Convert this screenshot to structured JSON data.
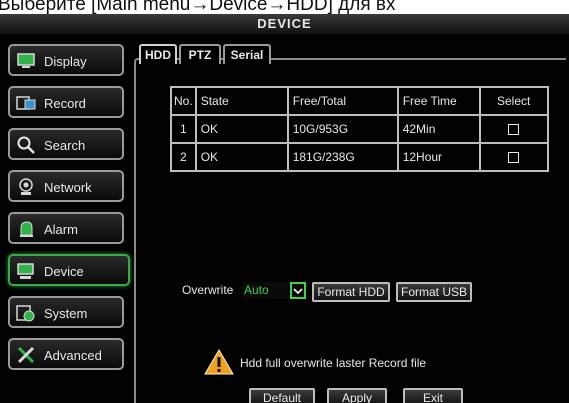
{
  "caption": "Выберите [Main menu→Device→HDD] для вх",
  "window": {
    "title": "DEVICE"
  },
  "sidebar": {
    "items": [
      {
        "label": "Display",
        "icon": "display-icon"
      },
      {
        "label": "Record",
        "icon": "record-icon"
      },
      {
        "label": "Search",
        "icon": "search-icon"
      },
      {
        "label": "Network",
        "icon": "network-icon"
      },
      {
        "label": "Alarm",
        "icon": "alarm-icon"
      },
      {
        "label": "Device",
        "icon": "device-icon",
        "active": true
      },
      {
        "label": "System",
        "icon": "system-icon"
      },
      {
        "label": "Advanced",
        "icon": "advanced-icon"
      }
    ]
  },
  "tabs": [
    "HDD",
    "PTZ",
    "Serial"
  ],
  "table": {
    "headers": [
      "No.",
      "State",
      "Free/Total",
      "Free Time",
      "Select"
    ],
    "rows": [
      {
        "no": "1",
        "state": "OK",
        "free_total": "10G/953G",
        "free_time": "42Min"
      },
      {
        "no": "2",
        "state": "OK",
        "free_total": "181G/238G",
        "free_time": "12Hour"
      }
    ]
  },
  "overwrite": {
    "label": "Overwrite",
    "value": "Auto"
  },
  "buttons": {
    "format_hdd": "Format HDD",
    "format_usb": "Format USB",
    "default": "Default",
    "apply": "Apply",
    "exit": "Exit"
  },
  "warning": "Hdd full overwrite laster Record file",
  "colors": {
    "accent": "#3bd34a",
    "active_border": "#3ea84a",
    "warning": "#f0a020"
  }
}
